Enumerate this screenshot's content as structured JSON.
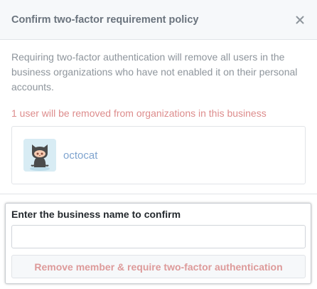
{
  "dialog": {
    "title": "Confirm two-factor requirement policy",
    "description": "Requiring two-factor authentication will remove all users in the business organizations who have not enabled it on their personal accounts.",
    "warning": "1 user will be removed from organizations in this business",
    "members": [
      {
        "name": "octocat",
        "avatar_icon": "octocat-icon"
      }
    ],
    "confirm": {
      "label": "Enter the business name to confirm",
      "input_value": "",
      "button_label": "Remove member & require two-factor authentication",
      "button_disabled": true
    }
  },
  "colors": {
    "header_bg": "#f6f8fa",
    "title": "#6a737d",
    "warning": "#dd8c8c",
    "link": "#7fa4cf",
    "danger_disabled": "#dd9a9a"
  }
}
